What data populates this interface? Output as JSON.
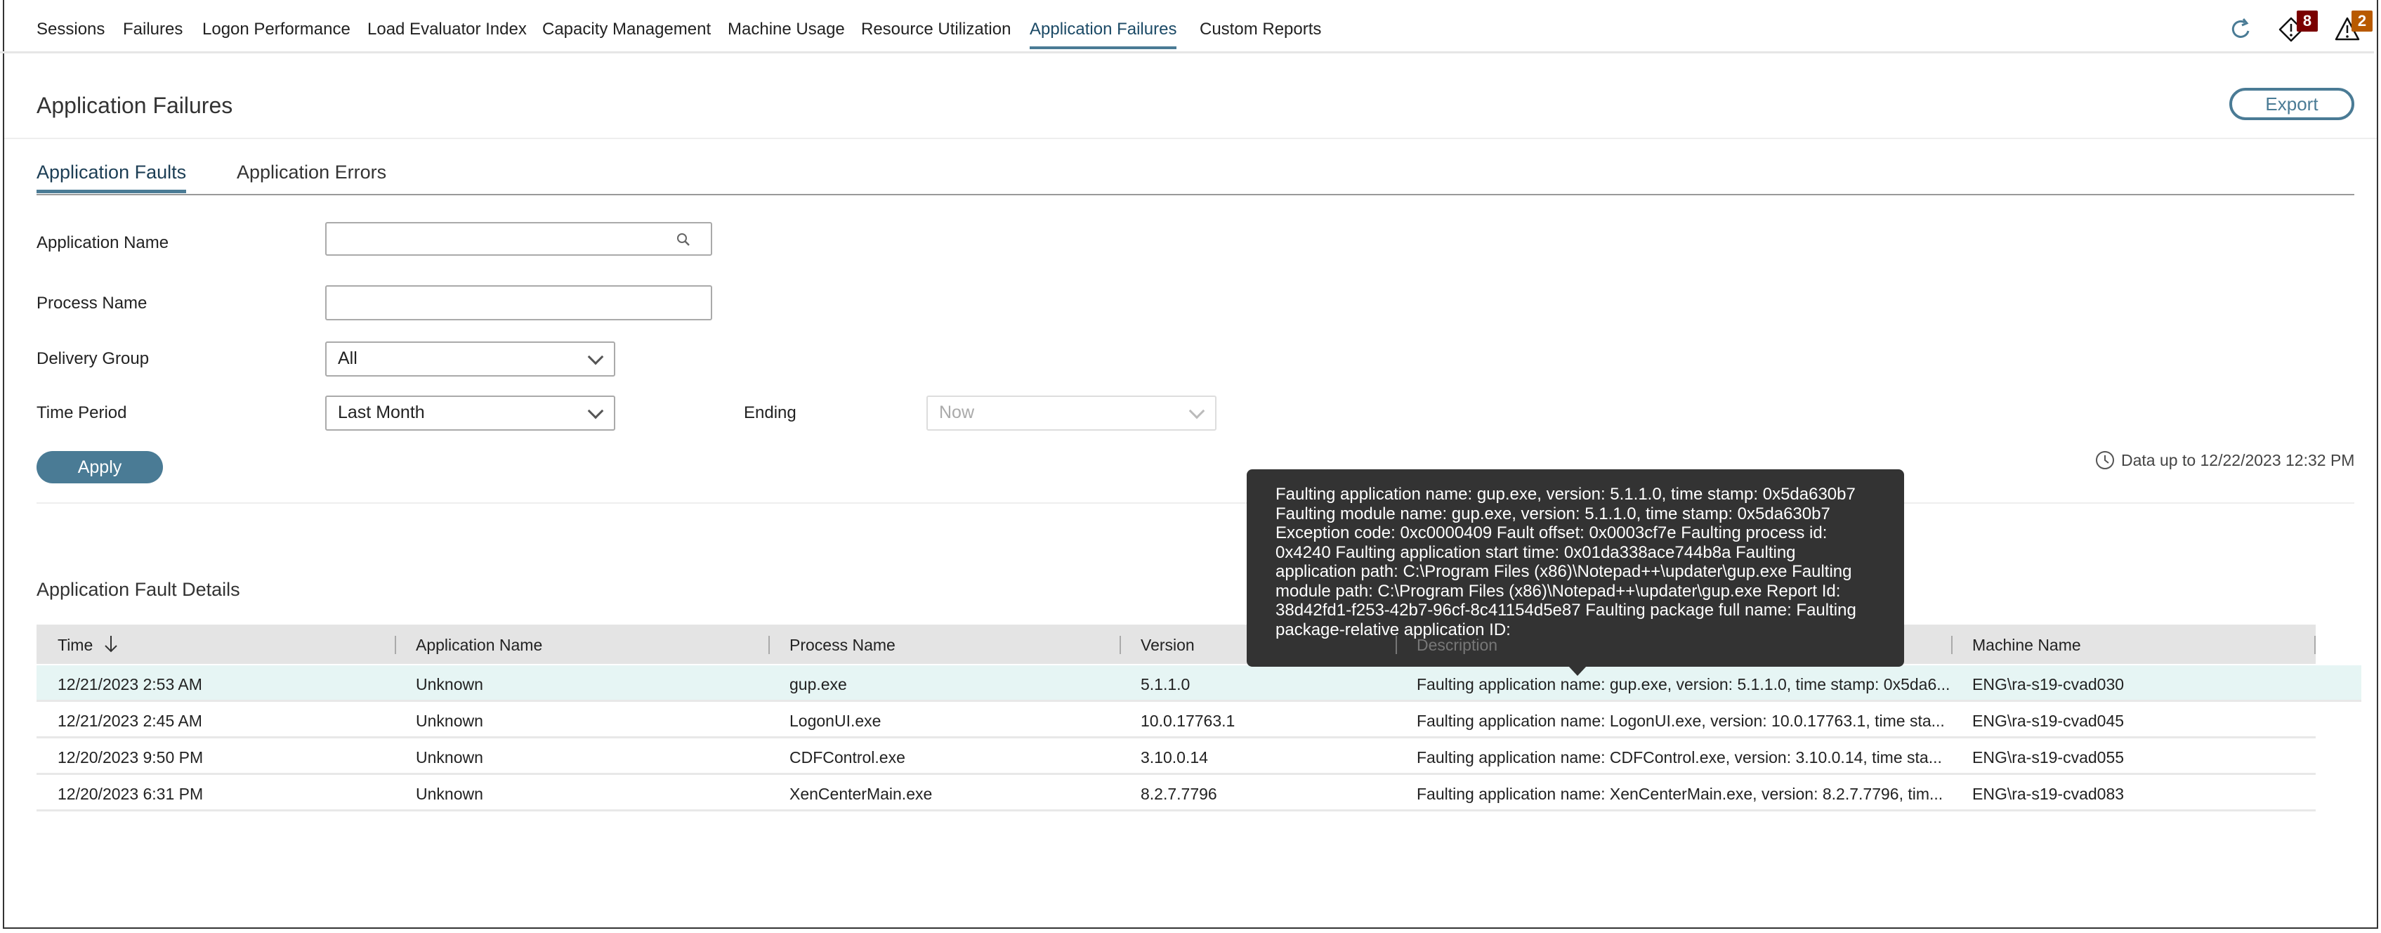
{
  "nav": {
    "items": [
      "Sessions",
      "Failures",
      "Logon Performance",
      "Load Evaluator Index",
      "Capacity Management",
      "Machine Usage",
      "Resource Utilization",
      "Application Failures",
      "Custom Reports"
    ],
    "active": "Application Failures"
  },
  "header_icons": {
    "refresh": "refresh-icon",
    "alerts_badge": "8",
    "alerts_badge_color": "#7a0000",
    "warnings_badge": "2",
    "warnings_badge_color": "#b85a00"
  },
  "page": {
    "title": "Application Failures",
    "export_label": "Export"
  },
  "tabs": [
    "Application Faults",
    "Application Errors"
  ],
  "filters": {
    "application_name_label": "Application Name",
    "application_name_value": "",
    "process_name_label": "Process Name",
    "process_name_value": "",
    "delivery_group_label": "Delivery Group",
    "delivery_group_value": "All",
    "time_period_label": "Time Period",
    "time_period_value": "Last Month",
    "ending_label": "Ending",
    "ending_value": "Now",
    "apply_label": "Apply",
    "data_up_to": "Data up to 12/22/2023 12:32 PM"
  },
  "table": {
    "title": "Application Fault Details",
    "columns": [
      "Time",
      "Application Name",
      "Process Name",
      "Version",
      "Description",
      "Machine Name"
    ],
    "rows": [
      [
        "12/21/2023 2:53 AM",
        "Unknown",
        "gup.exe",
        "5.1.1.0",
        "Faulting application name: gup.exe, version: 5.1.1.0, time stamp: 0x5da6...",
        "ENG\\ra-s19-cvad030"
      ],
      [
        "12/21/2023 2:45 AM",
        "Unknown",
        "LogonUI.exe",
        "10.0.17763.1",
        "Faulting application name: LogonUI.exe, version: 10.0.17763.1, time sta...",
        "ENG\\ra-s19-cvad045"
      ],
      [
        "12/20/2023 9:50 PM",
        "Unknown",
        "CDFControl.exe",
        "3.10.0.14",
        "Faulting application name: CDFControl.exe, version: 3.10.0.14, time sta...",
        "ENG\\ra-s19-cvad055"
      ],
      [
        "12/20/2023 6:31 PM",
        "Unknown",
        "XenCenterMain.exe",
        "8.2.7.7796",
        "Faulting application name: XenCenterMain.exe, version: 8.2.7.7796, tim...",
        "ENG\\ra-s19-cvad083"
      ]
    ]
  },
  "tooltip": {
    "text": "Faulting application name: gup.exe, version: 5.1.1.0, time stamp: 0x5da630b7 Faulting module name: gup.exe, version: 5.1.1.0, time stamp: 0x5da630b7 Exception code: 0xc0000409 Fault offset: 0x0003cf7e Faulting process id: 0x4240 Faulting application start time: 0x01da338ace744b8a Faulting application path: C:\\Program Files (x86)\\Notepad++\\updater\\gup.exe Faulting module path: C:\\Program Files (x86)\\Notepad++\\updater\\gup.exe Report Id: 38d42fd1-f253-42b7-96cf-8c41154d5e87 Faulting package full name: Faulting package-relative application ID:"
  }
}
